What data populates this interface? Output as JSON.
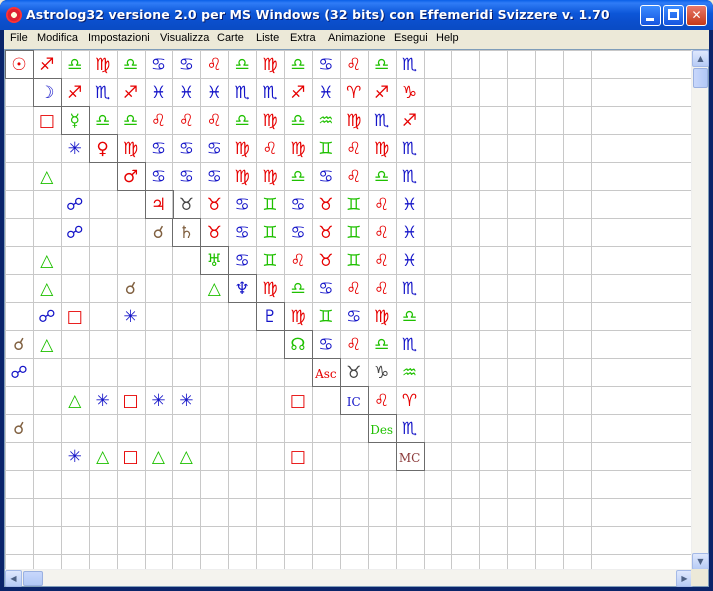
{
  "window": {
    "title": "Astrolog32 versione 2.0 per MS Windows (32 bits) con Effemeridi Svizzere v. 1.70"
  },
  "menu": [
    "File",
    "Modifica",
    "Impostazioni",
    "Visualizza",
    "Carte",
    "Liste",
    "Extra",
    "Animazione",
    "Esegui",
    "Help"
  ],
  "colors": {
    "red": "#e60000",
    "green": "#1fc000",
    "blue": "#1414c8",
    "magenta": "#c000c0",
    "olive": "#808000",
    "brown": "#806040",
    "dark": "#444444",
    "mcbrown": "#8b3a3a"
  },
  "grid": {
    "cols": 21,
    "rows": 18,
    "cells": [
      [
        "",
        "sun-glyph",
        "red",
        0,
        0
      ],
      [
        "",
        "sagittarius-glyph",
        "red",
        1,
        0
      ],
      [
        "",
        "libra-glyph",
        "green",
        2,
        0
      ],
      [
        "",
        "virgo-glyph",
        "red",
        3,
        0
      ],
      [
        "",
        "libra-glyph",
        "green",
        4,
        0
      ],
      [
        "",
        "cancer-glyph",
        "blue",
        5,
        0
      ],
      [
        "",
        "cancer-glyph",
        "blue",
        6,
        0
      ],
      [
        "",
        "leo-glyph",
        "red",
        7,
        0
      ],
      [
        "",
        "libra-glyph",
        "green",
        8,
        0
      ],
      [
        "",
        "virgo-glyph",
        "red",
        9,
        0
      ],
      [
        "",
        "libra-glyph",
        "green",
        10,
        0
      ],
      [
        "",
        "cancer-glyph",
        "blue",
        11,
        0
      ],
      [
        "",
        "leo-glyph",
        "red",
        12,
        0
      ],
      [
        "",
        "libra-glyph",
        "green",
        13,
        0
      ],
      [
        "",
        "scorpio-glyph",
        "blue",
        14,
        0
      ],
      [
        "",
        "moon-glyph",
        "blue",
        1,
        1
      ],
      [
        "",
        "sagittarius-glyph",
        "red",
        2,
        1
      ],
      [
        "",
        "scorpio-glyph",
        "blue",
        3,
        1
      ],
      [
        "",
        "sagittarius-glyph",
        "red",
        4,
        1
      ],
      [
        "",
        "pisces-glyph",
        "blue",
        5,
        1
      ],
      [
        "",
        "pisces-glyph",
        "blue",
        6,
        1
      ],
      [
        "",
        "pisces-glyph",
        "blue",
        7,
        1
      ],
      [
        "",
        "scorpio-glyph",
        "blue",
        8,
        1
      ],
      [
        "",
        "scorpio-glyph",
        "blue",
        9,
        1
      ],
      [
        "",
        "sagittarius-glyph",
        "red",
        10,
        1
      ],
      [
        "",
        "pisces-glyph",
        "blue",
        11,
        1
      ],
      [
        "",
        "aries-glyph",
        "red",
        12,
        1
      ],
      [
        "",
        "sagittarius-glyph",
        "red",
        13,
        1
      ],
      [
        "",
        "capricorn-glyph",
        "red",
        14,
        1
      ],
      [
        "",
        "square-aspect",
        "red",
        1,
        2
      ],
      [
        "",
        "mercury-glyph",
        "green",
        2,
        2
      ],
      [
        "",
        "libra-glyph",
        "green",
        3,
        2
      ],
      [
        "",
        "libra-glyph",
        "green",
        4,
        2
      ],
      [
        "",
        "leo-glyph",
        "red",
        5,
        2
      ],
      [
        "",
        "leo-glyph",
        "red",
        6,
        2
      ],
      [
        "",
        "leo-glyph",
        "red",
        7,
        2
      ],
      [
        "",
        "libra-glyph",
        "green",
        8,
        2
      ],
      [
        "",
        "virgo-glyph",
        "red",
        9,
        2
      ],
      [
        "",
        "libra-glyph",
        "green",
        10,
        2
      ],
      [
        "",
        "aquarius-glyph",
        "green",
        11,
        2
      ],
      [
        "",
        "virgo-glyph",
        "red",
        12,
        2
      ],
      [
        "",
        "scorpio-glyph",
        "blue",
        13,
        2
      ],
      [
        "",
        "sagittarius-glyph",
        "red",
        14,
        2
      ],
      [
        "",
        "sextile-aspect",
        "blue",
        2,
        3
      ],
      [
        "",
        "venus-glyph",
        "red",
        3,
        3
      ],
      [
        "",
        "virgo-glyph",
        "red",
        4,
        3
      ],
      [
        "",
        "cancer-glyph",
        "blue",
        5,
        3
      ],
      [
        "",
        "cancer-glyph",
        "blue",
        6,
        3
      ],
      [
        "",
        "cancer-glyph",
        "blue",
        7,
        3
      ],
      [
        "",
        "virgo-glyph",
        "red",
        8,
        3
      ],
      [
        "",
        "leo-glyph",
        "red",
        9,
        3
      ],
      [
        "",
        "virgo-glyph",
        "red",
        10,
        3
      ],
      [
        "",
        "gemini-glyph",
        "green",
        11,
        3
      ],
      [
        "",
        "leo-glyph",
        "red",
        12,
        3
      ],
      [
        "",
        "virgo-glyph",
        "red",
        13,
        3
      ],
      [
        "",
        "scorpio-glyph",
        "blue",
        14,
        3
      ],
      [
        "",
        "trine-aspect",
        "green",
        1,
        4
      ],
      [
        "",
        "mars-glyph",
        "red",
        4,
        4
      ],
      [
        "",
        "cancer-glyph",
        "blue",
        5,
        4
      ],
      [
        "",
        "cancer-glyph",
        "blue",
        6,
        4
      ],
      [
        "",
        "cancer-glyph",
        "blue",
        7,
        4
      ],
      [
        "",
        "virgo-glyph",
        "red",
        8,
        4
      ],
      [
        "",
        "virgo-glyph",
        "red",
        9,
        4
      ],
      [
        "",
        "libra-glyph",
        "green",
        10,
        4
      ],
      [
        "",
        "cancer-glyph",
        "blue",
        11,
        4
      ],
      [
        "",
        "leo-glyph",
        "red",
        12,
        4
      ],
      [
        "",
        "libra-glyph",
        "green",
        13,
        4
      ],
      [
        "",
        "scorpio-glyph",
        "blue",
        14,
        4
      ],
      [
        "",
        "opposition-aspect",
        "blue",
        2,
        5
      ],
      [
        "",
        "jupiter-glyph",
        "red",
        5,
        5
      ],
      [
        "",
        "taurus-glyph",
        "dark",
        6,
        5
      ],
      [
        "",
        "taurus-glyph",
        "red",
        7,
        5
      ],
      [
        "",
        "cancer-glyph",
        "blue",
        8,
        5
      ],
      [
        "",
        "gemini-glyph",
        "green",
        9,
        5
      ],
      [
        "",
        "cancer-glyph",
        "blue",
        10,
        5
      ],
      [
        "",
        "taurus-glyph",
        "red",
        11,
        5
      ],
      [
        "",
        "gemini-glyph",
        "green",
        12,
        5
      ],
      [
        "",
        "leo-glyph",
        "red",
        13,
        5
      ],
      [
        "",
        "pisces-glyph",
        "blue",
        14,
        5
      ],
      [
        "",
        "opposition-aspect",
        "blue",
        2,
        6
      ],
      [
        "",
        "conjunction-aspect",
        "brown",
        5,
        6
      ],
      [
        "",
        "saturn-glyph",
        "brown",
        6,
        6
      ],
      [
        "",
        "taurus-glyph",
        "red",
        7,
        6
      ],
      [
        "",
        "cancer-glyph",
        "blue",
        8,
        6
      ],
      [
        "",
        "gemini-glyph",
        "green",
        9,
        6
      ],
      [
        "",
        "cancer-glyph",
        "blue",
        10,
        6
      ],
      [
        "",
        "taurus-glyph",
        "red",
        11,
        6
      ],
      [
        "",
        "gemini-glyph",
        "green",
        12,
        6
      ],
      [
        "",
        "leo-glyph",
        "red",
        13,
        6
      ],
      [
        "",
        "pisces-glyph",
        "blue",
        14,
        6
      ],
      [
        "",
        "trine-aspect",
        "green",
        1,
        7
      ],
      [
        "",
        "uranus-glyph",
        "green",
        7,
        7
      ],
      [
        "",
        "cancer-glyph",
        "blue",
        8,
        7
      ],
      [
        "",
        "gemini-glyph",
        "green",
        9,
        7
      ],
      [
        "",
        "leo-glyph",
        "red",
        10,
        7
      ],
      [
        "",
        "taurus-glyph",
        "red",
        11,
        7
      ],
      [
        "",
        "gemini-glyph",
        "green",
        12,
        7
      ],
      [
        "",
        "leo-glyph",
        "red",
        13,
        7
      ],
      [
        "",
        "pisces-glyph",
        "blue",
        14,
        7
      ],
      [
        "",
        "trine-aspect",
        "green",
        1,
        8
      ],
      [
        "",
        "conjunction-aspect",
        "brown",
        4,
        8
      ],
      [
        "",
        "trine-aspect",
        "green",
        7,
        8
      ],
      [
        "",
        "neptune-glyph",
        "blue",
        8,
        8
      ],
      [
        "",
        "virgo-glyph",
        "red",
        9,
        8
      ],
      [
        "",
        "libra-glyph",
        "green",
        10,
        8
      ],
      [
        "",
        "cancer-glyph",
        "blue",
        11,
        8
      ],
      [
        "",
        "leo-glyph",
        "red",
        12,
        8
      ],
      [
        "",
        "leo-glyph",
        "red",
        13,
        8
      ],
      [
        "",
        "scorpio-glyph",
        "blue",
        14,
        8
      ],
      [
        "",
        "opposition-aspect",
        "blue",
        1,
        9
      ],
      [
        "",
        "square-aspect",
        "red",
        2,
        9
      ],
      [
        "",
        "sextile-aspect",
        "blue",
        4,
        9
      ],
      [
        "",
        "pluto-glyph",
        "blue",
        9,
        9
      ],
      [
        "",
        "virgo-glyph",
        "red",
        10,
        9
      ],
      [
        "",
        "gemini-glyph",
        "green",
        11,
        9
      ],
      [
        "",
        "cancer-glyph",
        "blue",
        12,
        9
      ],
      [
        "",
        "virgo-glyph",
        "red",
        13,
        9
      ],
      [
        "",
        "libra-glyph",
        "green",
        14,
        9
      ],
      [
        "",
        "conjunction-aspect",
        "brown",
        0,
        10
      ],
      [
        "",
        "trine-aspect",
        "green",
        1,
        10
      ],
      [
        "",
        "node-glyph",
        "green",
        10,
        10
      ],
      [
        "",
        "cancer-glyph",
        "blue",
        11,
        10
      ],
      [
        "",
        "leo-glyph",
        "red",
        12,
        10
      ],
      [
        "",
        "libra-glyph",
        "green",
        13,
        10
      ],
      [
        "",
        "scorpio-glyph",
        "blue",
        14,
        10
      ],
      [
        "",
        "opposition-aspect",
        "blue",
        0,
        11
      ],
      [
        "Asc",
        "ascendant-label",
        "red",
        11,
        11
      ],
      [
        "",
        "taurus-glyph",
        "dark",
        12,
        11
      ],
      [
        "",
        "capricorn-glyph",
        "dark",
        13,
        11
      ],
      [
        "",
        "aquarius-glyph",
        "green",
        14,
        11
      ],
      [
        "",
        "trine-aspect",
        "green",
        2,
        12
      ],
      [
        "",
        "sextile-aspect",
        "blue",
        3,
        12
      ],
      [
        "",
        "square-aspect",
        "red",
        4,
        12
      ],
      [
        "",
        "sextile-aspect",
        "blue",
        5,
        12
      ],
      [
        "",
        "sextile-aspect",
        "blue",
        6,
        12
      ],
      [
        "",
        "square-aspect",
        "red",
        10,
        12
      ],
      [
        "IC",
        "imum-coeli-label",
        "blue",
        12,
        12
      ],
      [
        "",
        "leo-glyph",
        "red",
        13,
        12
      ],
      [
        "",
        "aries-glyph",
        "red",
        14,
        12
      ],
      [
        "",
        "conjunction-aspect",
        "brown",
        0,
        13
      ],
      [
        "Des",
        "descendant-label",
        "green",
        13,
        13
      ],
      [
        "",
        "scorpio-glyph",
        "blue",
        14,
        13
      ],
      [
        "",
        "sextile-aspect",
        "blue",
        2,
        14
      ],
      [
        "",
        "trine-aspect",
        "green",
        3,
        14
      ],
      [
        "",
        "square-aspect",
        "red",
        4,
        14
      ],
      [
        "",
        "trine-aspect",
        "green",
        5,
        14
      ],
      [
        "",
        "trine-aspect",
        "green",
        6,
        14
      ],
      [
        "",
        "square-aspect",
        "red",
        10,
        14
      ],
      [
        "MC",
        "midheaven-label",
        "mcbrown",
        14,
        14
      ]
    ]
  },
  "scrollbars": {
    "up": "▲",
    "down": "▼",
    "left": "◀",
    "right": "▶"
  }
}
